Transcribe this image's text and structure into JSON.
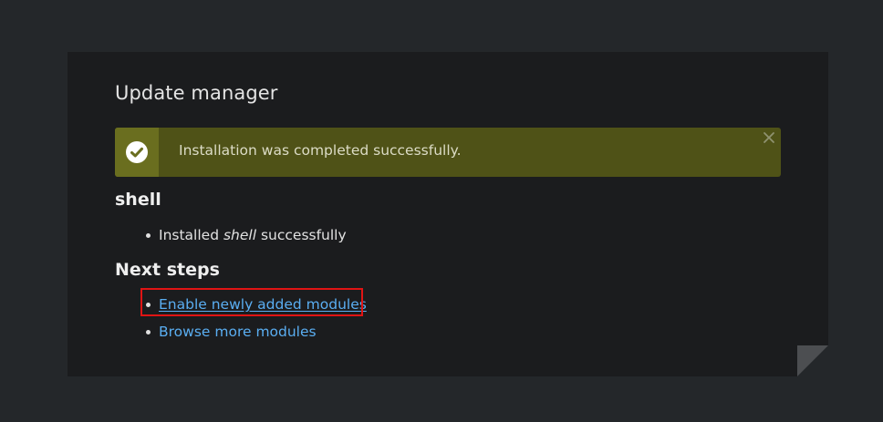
{
  "page": {
    "title": "Update manager"
  },
  "status": {
    "message": "Installation was completed successfully.",
    "icon": "check-circle-icon",
    "close_icon": "close-icon",
    "colors": {
      "background": "#4f5217",
      "icon_background": "#6a6e1f"
    }
  },
  "project": {
    "heading": "shell",
    "items": [
      {
        "prefix": "Installed ",
        "name": "shell",
        "suffix": " successfully"
      }
    ]
  },
  "next_steps": {
    "heading": "Next steps",
    "links": [
      {
        "label": "Enable newly added modules"
      },
      {
        "label": "Browse more modules"
      }
    ]
  },
  "colors": {
    "page_background": "#24272a",
    "panel_background": "#1b1c1e",
    "link": "#5aaef2",
    "highlight": "#e01414"
  }
}
